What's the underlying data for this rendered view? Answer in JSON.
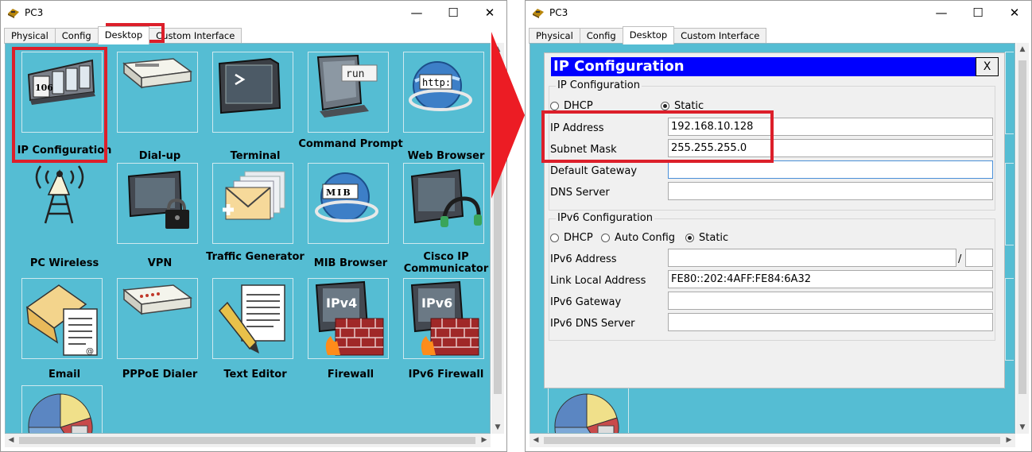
{
  "window_title": "PC3",
  "tabs": [
    "Physical",
    "Config",
    "Desktop",
    "Custom Interface"
  ],
  "active_tab": "Desktop",
  "desktop_apps": [
    {
      "label": "IP Configuration",
      "icon": "ip-config-icon"
    },
    {
      "label": "Dial-up",
      "icon": "modem-icon"
    },
    {
      "label": "Terminal",
      "icon": "terminal-icon"
    },
    {
      "label": "Command Prompt",
      "icon": "command-prompt-icon"
    },
    {
      "label": "Web Browser",
      "icon": "web-browser-icon"
    },
    {
      "label": "PC Wireless",
      "icon": "wireless-tower-icon"
    },
    {
      "label": "VPN",
      "icon": "vpn-lock-icon"
    },
    {
      "label": "Traffic Generator",
      "icon": "traffic-generator-icon"
    },
    {
      "label": "MIB Browser",
      "icon": "mib-browser-icon"
    },
    {
      "label": "Cisco IP Communicator",
      "icon": "ip-communicator-icon"
    },
    {
      "label": "Email",
      "icon": "email-icon"
    },
    {
      "label": "PPPoE Dialer",
      "icon": "pppoe-icon"
    },
    {
      "label": "Text Editor",
      "icon": "text-editor-icon"
    },
    {
      "label": "Firewall",
      "icon": "firewall-icon"
    },
    {
      "label": "IPv6 Firewall",
      "icon": "ipv6-firewall-icon"
    },
    {
      "label": "",
      "icon": "pie-chart-icon"
    }
  ],
  "icon_text": {
    "ip_config": "106",
    "command_prompt": "run",
    "web_browser": "http:",
    "mib": "MIB",
    "ipv4": "IPv4",
    "ipv6": "IPv6"
  },
  "ip_dialog": {
    "title": "IP Configuration",
    "close": "X",
    "ipv4_group": "IP Configuration",
    "ipv4_modes": [
      "DHCP",
      "Static"
    ],
    "ipv4_selected": "Static",
    "fields": [
      {
        "label": "IP Address",
        "value": "192.168.10.128"
      },
      {
        "label": "Subnet Mask",
        "value": "255.255.255.0"
      },
      {
        "label": "Default Gateway",
        "value": ""
      },
      {
        "label": "DNS Server",
        "value": ""
      }
    ],
    "ipv6_group": "IPv6 Configuration",
    "ipv6_modes": [
      "DHCP",
      "Auto Config",
      "Static"
    ],
    "ipv6_selected": "Static",
    "ipv6_fields": [
      {
        "label": "IPv6 Address",
        "value": ""
      },
      {
        "label": "Link Local Address",
        "value": "FE80::202:4AFF:FE84:6A32"
      },
      {
        "label": "IPv6 Gateway",
        "value": ""
      },
      {
        "label": "IPv6 DNS Server",
        "value": ""
      }
    ],
    "prefix_separator": "/"
  },
  "colors": {
    "desktop_bg": "#55bdd3",
    "title_blue": "#0000ff",
    "highlight_red": "#dc1f2a"
  }
}
